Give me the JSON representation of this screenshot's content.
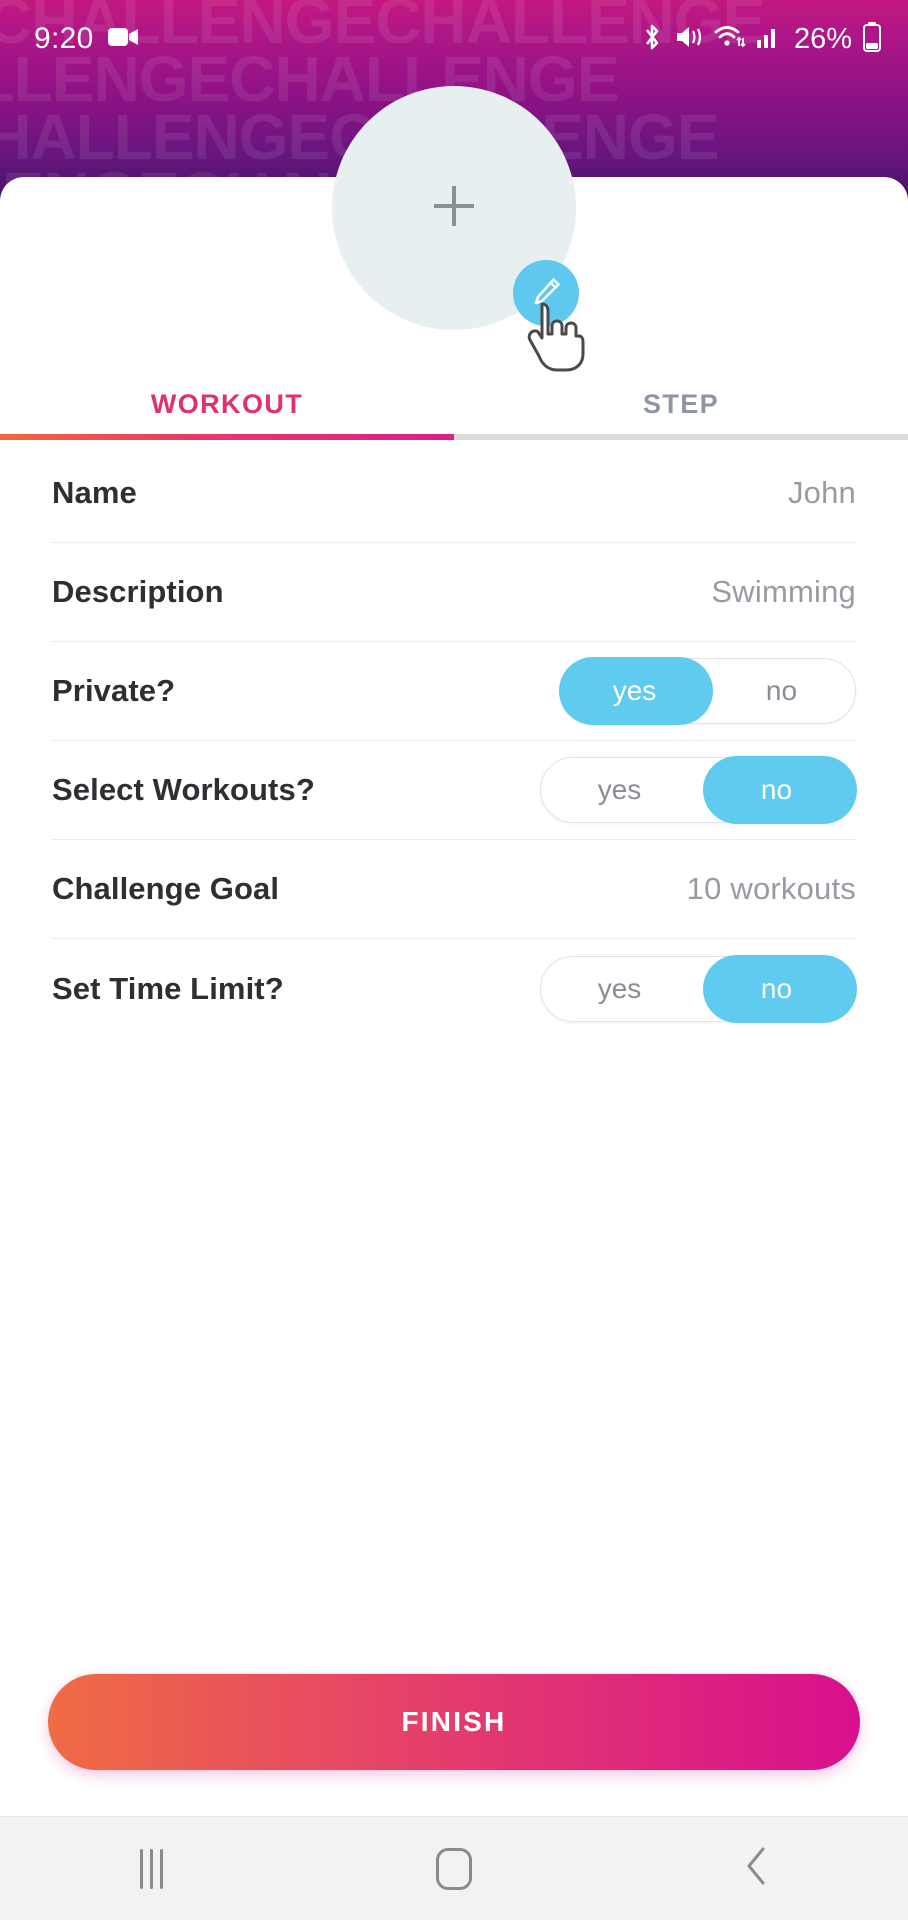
{
  "status_bar": {
    "time": "9:20",
    "battery_percent": "26%",
    "icons": [
      "video-recording-icon",
      "bluetooth-icon",
      "mute-vibrate-icon",
      "wifi-icon",
      "cellular-signal-icon",
      "battery-icon"
    ]
  },
  "header": {
    "watermark_text": "CHALLENGECHALLENGE",
    "gradient_top": "#c3187f",
    "gradient_bottom": "#2e1054"
  },
  "avatar": {
    "add_photo_icon": "plus-icon",
    "edit_badge_icon": "pencil-icon",
    "badge_color": "#5ec8ef",
    "circle_color": "#e7eff1"
  },
  "tabs": {
    "items": [
      {
        "label": "WORKOUT",
        "active": true
      },
      {
        "label": "STEP",
        "active": false
      }
    ],
    "active_color": "#e0306e",
    "inactive_color": "#8e95a3"
  },
  "form": {
    "rows": [
      {
        "label": "Name",
        "type": "value",
        "value": "John"
      },
      {
        "label": "Description",
        "type": "value",
        "value": "Swimming"
      },
      {
        "label": "Private?",
        "type": "toggle",
        "yes": "yes",
        "no": "no",
        "selected": "yes"
      },
      {
        "label": "Select Workouts?",
        "type": "toggle",
        "yes": "yes",
        "no": "no",
        "selected": "no"
      },
      {
        "label": "Challenge Goal",
        "type": "value",
        "value": "10 workouts"
      },
      {
        "label": "Set Time Limit?",
        "type": "toggle",
        "yes": "yes",
        "no": "no",
        "selected": "no"
      }
    ],
    "toggle_on_color": "#5ecbef"
  },
  "finish": {
    "label": "FINISH",
    "gradient_start": "#ef6c44",
    "gradient_end": "#d8108e"
  },
  "navbar": {
    "recents": "recents-icon",
    "home": "home-icon",
    "back": "back-icon"
  }
}
